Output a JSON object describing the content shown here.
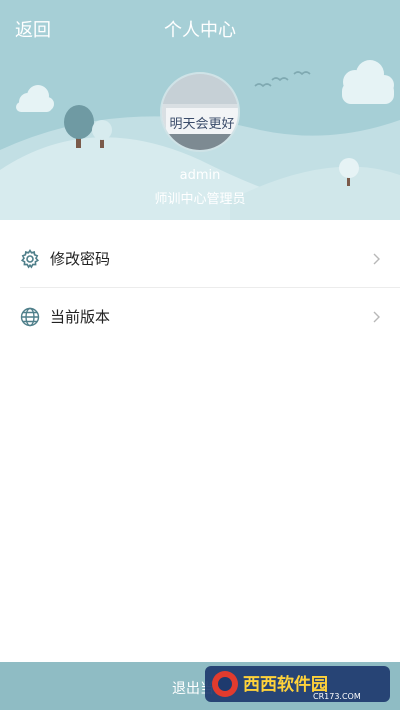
{
  "header": {
    "back_label": "返回",
    "title": "个人中心",
    "background_color": "#a6cfd6"
  },
  "profile": {
    "avatar_icon": "avatar-photo",
    "avatar_text": "明天会更好",
    "username": "admin",
    "role": "师训中心管理员"
  },
  "menu": {
    "items": [
      {
        "label": "修改密码",
        "icon": "gear-icon"
      },
      {
        "label": "当前版本",
        "icon": "globe-icon"
      }
    ],
    "chevron_icon": "chevron-right-icon"
  },
  "footer": {
    "logout_label": "退出当前",
    "background_color": "#8fbcc4"
  },
  "watermark": {
    "text": "西西软件园",
    "subtext": "CR173.COM"
  }
}
